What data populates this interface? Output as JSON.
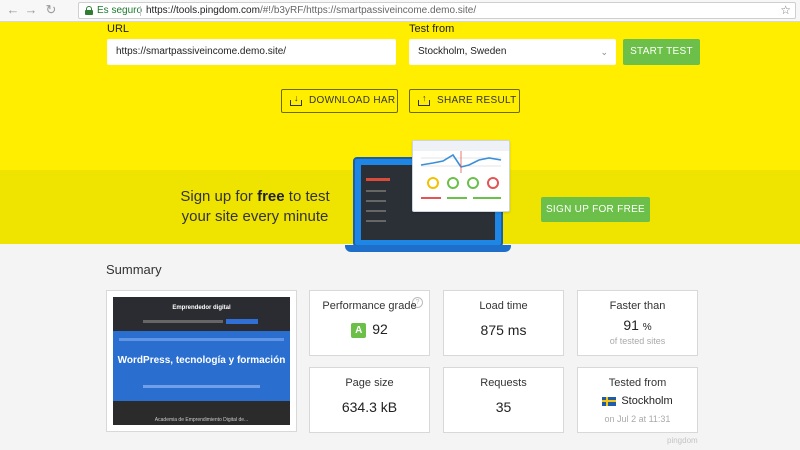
{
  "browser": {
    "secure_label": "Es seguro",
    "url_host": "https://tools.pingdom.com",
    "url_path": "/#!/b3yRF/https://smartpassiveincome.demo.site/"
  },
  "form": {
    "url_label": "URL",
    "url_value": "https://smartpassiveincome.demo.site/",
    "test_from_label": "Test from",
    "test_from_value": "Stockholm, Sweden",
    "start_test_label": "START TEST",
    "download_har_label": "DOWNLOAD HAR",
    "share_result_label": "SHARE RESULT"
  },
  "promo": {
    "line1_pre": "Sign up for ",
    "line1_bold": "free",
    "line1_post": " to test",
    "line2": "your site every minute",
    "button_label": "SIGN UP FOR FREE"
  },
  "summary": {
    "title": "Summary",
    "thumbnail": {
      "site_name": "Emprendedor digital",
      "headline": "WordPress, tecnología y formación",
      "caption": "Academia de Emprendimiento Digital de..."
    },
    "cards": {
      "performance": {
        "title": "Performance grade",
        "grade": "A",
        "value": "92",
        "help": "?"
      },
      "load_time": {
        "title": "Load time",
        "value": "875 ms"
      },
      "faster_than": {
        "title": "Faster than",
        "value": "91",
        "unit": "%",
        "sub": "of tested sites"
      },
      "page_size": {
        "title": "Page size",
        "value": "634.3 kB"
      },
      "requests": {
        "title": "Requests",
        "value": "35"
      },
      "tested_from": {
        "title": "Tested from",
        "value": "Stockholm",
        "sub": "on Jul 2 at 11:31"
      }
    }
  },
  "footer_mark": "pingdom",
  "colors": {
    "yellow": "#ffee00",
    "green": "#6cc04a",
    "laptop_blue": "#1e87e5"
  },
  "icons": [
    "back-arrow-icon",
    "forward-arrow-icon",
    "reload-icon",
    "lock-icon",
    "star-icon",
    "chevron-down-icon",
    "download-icon",
    "share-icon",
    "help-icon",
    "sweden-flag-icon"
  ]
}
